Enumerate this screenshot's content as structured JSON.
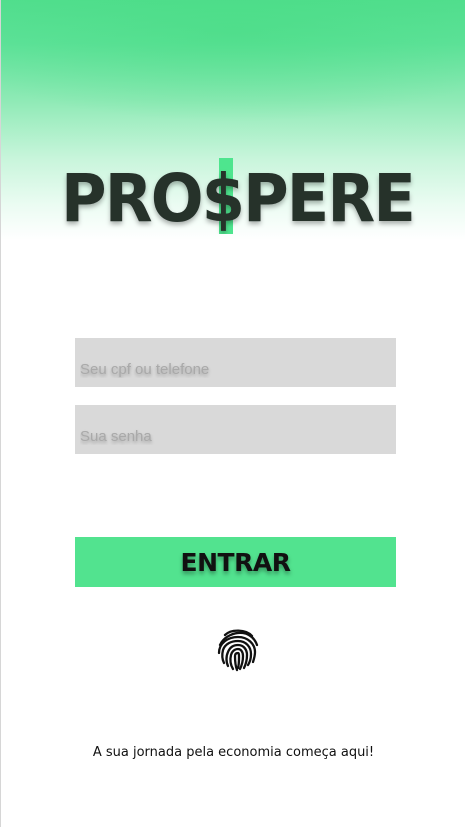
{
  "logo": {
    "text_left": "PRO",
    "dollar_glyph": "$",
    "text_right": "PERE",
    "text_color": "#26302c",
    "accent_color": "#4ee58e"
  },
  "login": {
    "cpf_placeholder": "Seu cpf ou telefone",
    "password_placeholder": "Sua senha",
    "enter_label": "ENTRAR",
    "biometric_icon": "fingerprint-icon"
  },
  "footer": {
    "tagline": "A sua jornada pela economia começa aqui!"
  },
  "colors": {
    "brand_green": "#52e38f",
    "field_background": "#d9d9d9",
    "button_text": "#111111"
  }
}
